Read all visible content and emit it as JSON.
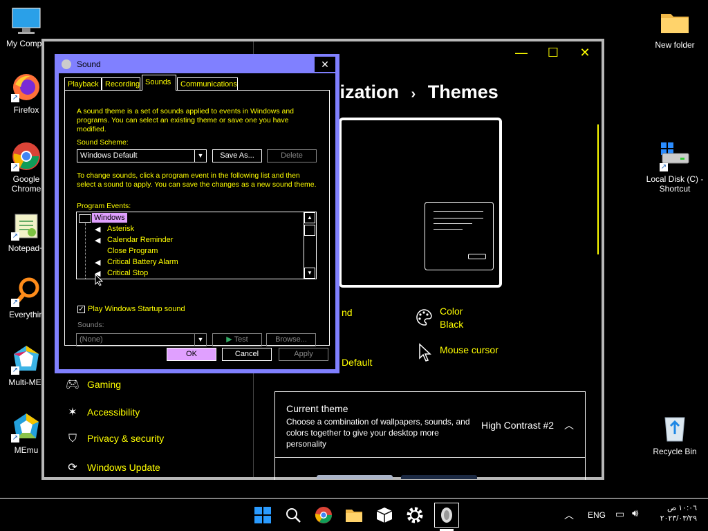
{
  "desktop": {
    "icons_left": [
      {
        "label": "My Compu",
        "icon": "computer-icon"
      },
      {
        "label": "Firefox",
        "icon": "firefox-icon"
      },
      {
        "label": "Google Chrome",
        "icon": "chrome-icon"
      },
      {
        "label": "Notepad+",
        "icon": "notepad-plus-icon"
      },
      {
        "label": "Everythin",
        "icon": "everything-search-icon"
      },
      {
        "label": "Multi-MEr",
        "icon": "multi-memu-icon"
      },
      {
        "label": "MEmu",
        "icon": "memu-icon"
      }
    ],
    "icons_right": [
      {
        "label": "New folder",
        "icon": "folder-icon"
      },
      {
        "label": "Local Disk (C) - Shortcut",
        "icon": "drive-icon"
      },
      {
        "label": "Recycle Bin",
        "icon": "recycle-bin-icon"
      }
    ]
  },
  "settings": {
    "breadcrumb_parent": "lization",
    "breadcrumb_sep": "›",
    "breadcrumb_current": "Themes",
    "controls": {
      "minimize": "—",
      "maximize": "☐",
      "close": "✕"
    },
    "nav": [
      {
        "label": "Gaming",
        "icon": "gamepad-icon"
      },
      {
        "label": "Accessibility",
        "icon": "accessibility-icon"
      },
      {
        "label": "Privacy & security",
        "icon": "shield-icon"
      },
      {
        "label": "Windows Update",
        "icon": "update-icon"
      }
    ],
    "options": {
      "partial_nd": "nd",
      "partial_default": "Default",
      "color_label": "Color",
      "color_value": "Black",
      "cursor_label": "Mouse cursor"
    },
    "current_theme": {
      "title": "Current theme",
      "description": "Choose a combination of wallpapers, sounds, and colors together to give your desktop more personality",
      "value": "High Contrast #2"
    }
  },
  "dialog": {
    "title": "Sound",
    "tabs": [
      "Playback",
      "Recording",
      "Sounds",
      "Communications"
    ],
    "active_tab": "Sounds",
    "intro": "A sound theme is a set of sounds applied to events in Windows and programs. You can select an existing theme or save one you have modified.",
    "scheme_label": "Sound Scheme:",
    "scheme_value": "Windows Default",
    "save_as": "Save As...",
    "delete": "Delete",
    "instructions": "To change sounds, click a program event in the following list and then select a sound to apply. You can save the changes as a new sound theme.",
    "events_label": "Program Events:",
    "events_root": "Windows",
    "events": [
      {
        "label": "Asterisk",
        "has_sound": true
      },
      {
        "label": "Calendar Reminder",
        "has_sound": true
      },
      {
        "label": "Close Program",
        "has_sound": false
      },
      {
        "label": "Critical Battery Alarm",
        "has_sound": true
      },
      {
        "label": "Critical Stop",
        "has_sound": true
      }
    ],
    "startup_checkbox": "Play Windows Startup sound",
    "startup_checked": true,
    "sounds_label": "Sounds:",
    "sounds_value": "(None)",
    "test": "Test",
    "browse": "Browse...",
    "ok": "OK",
    "cancel": "Cancel",
    "apply": "Apply"
  },
  "taskbar": {
    "language": "ENG",
    "time": "١٠:٠٦ ص",
    "date": "٢٠٢٣/٠٣/٢٩"
  },
  "colors": {
    "accent_yellow": "#ffff00",
    "dialog_frame": "#8080ff",
    "ok_button": "#e0a0ff"
  }
}
